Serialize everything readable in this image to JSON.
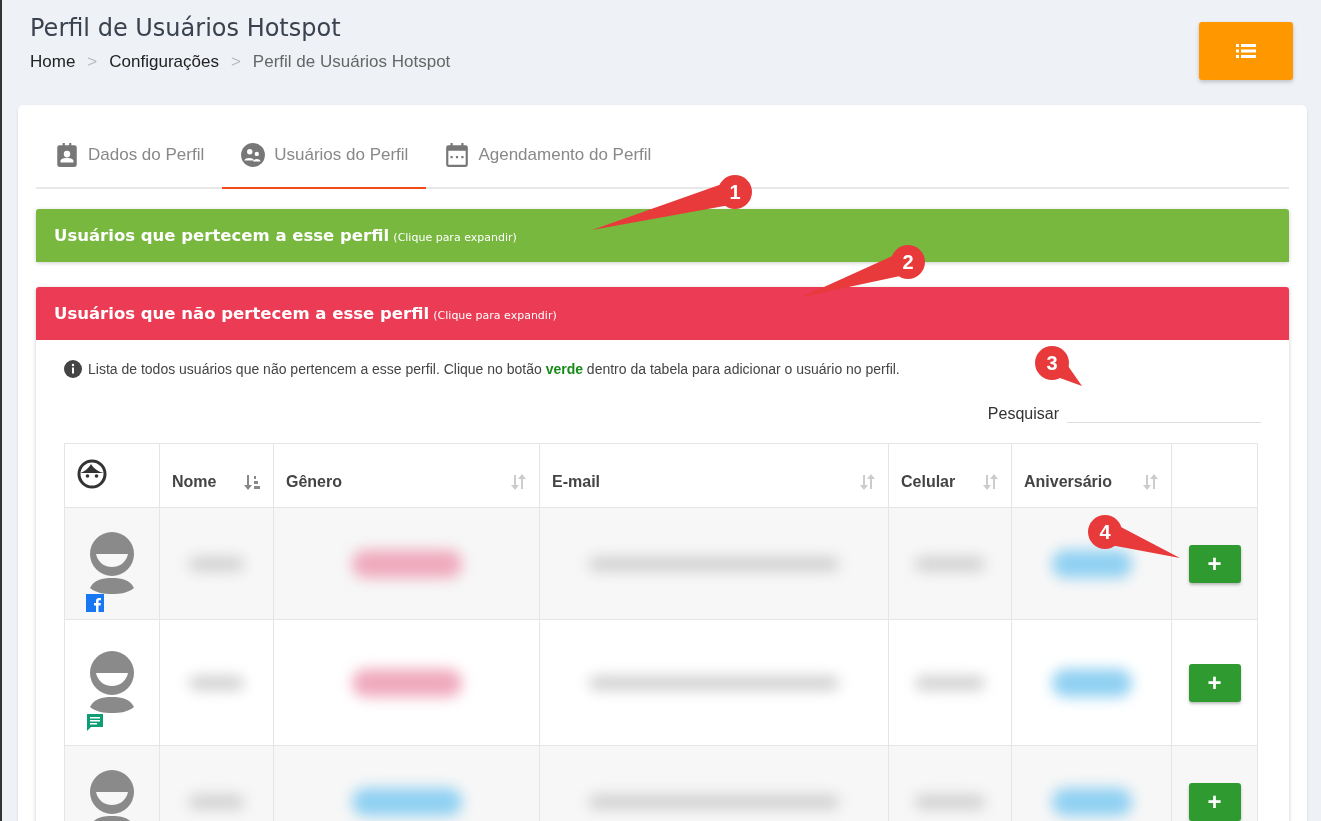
{
  "page": {
    "title": "Perfil de Usuários Hotspot"
  },
  "breadcrumb": [
    {
      "label": "Home",
      "current": false
    },
    {
      "label": "Configurações",
      "current": false
    },
    {
      "label": "Perfil de Usuários Hotspot",
      "current": true
    }
  ],
  "separator": ">",
  "tabs": [
    {
      "label": "Dados do Perfil",
      "kind": "contact",
      "selected": false
    },
    {
      "label": "Usuários do Perfil",
      "kind": "group",
      "selected": true
    },
    {
      "label": "Agendamento do Perfil",
      "kind": "calendar",
      "selected": false
    }
  ],
  "panels": [
    {
      "title": "Usuários que pertecem a esse perfil",
      "hint": "(Clique para expandir)",
      "color": "#78b83f",
      "expanded": false
    },
    {
      "title": "Usuários que não pertecem a esse perfil",
      "hint": "(Clique para expandir)",
      "color": "#eb3b55",
      "expanded": true
    }
  ],
  "info": "Lista de todos usuários que não pertencem a esse perfil. Clique no botão **verde** dentro da tabela para adicionar o usuário no perfil.",
  "search": {
    "label": "Pesquisar"
  },
  "table": {
    "columns": [
      {
        "label": "Nome",
        "sorted": true
      },
      {
        "label": "Gênero",
        "sorted": false
      },
      {
        "label": "E-mail",
        "sorted": false
      },
      {
        "label": "Celular",
        "sorted": false
      },
      {
        "label": "Aniversário",
        "sorted": false
      }
    ],
    "rows": [
      {
        "kind": "facebook",
        "color": "#efa9bd",
        "action": "+"
      },
      {
        "kind": "message",
        "color": "#efa9bd",
        "action": "+"
      },
      {
        "kind": "plain",
        "color": "#8fd0f2",
        "action": "+"
      }
    ]
  },
  "callouts": [
    "1",
    "2",
    "3",
    "4"
  ]
}
